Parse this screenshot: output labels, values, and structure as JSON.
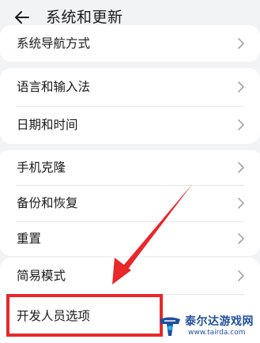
{
  "header": {
    "title": "系统和更新",
    "back_icon": "arrow-left-icon"
  },
  "groups": [
    {
      "items": [
        {
          "label": "系统导航方式",
          "icon": "chevron-right-icon"
        }
      ]
    },
    {
      "items": [
        {
          "label": "语言和输入法",
          "icon": "chevron-right-icon"
        },
        {
          "label": "日期和时间",
          "icon": "chevron-right-icon"
        }
      ]
    },
    {
      "items": [
        {
          "label": "手机克隆",
          "icon": "chevron-right-icon"
        },
        {
          "label": "备份和恢复",
          "icon": "chevron-right-icon"
        },
        {
          "label": "重置",
          "icon": "chevron-right-icon"
        }
      ]
    },
    {
      "items": [
        {
          "label": "简易模式",
          "icon": "chevron-right-icon"
        },
        {
          "label": "开发人员选项"
        }
      ]
    }
  ],
  "annotation": {
    "highlight_color": "#e8282b"
  },
  "watermark": {
    "title": "泰尔达游戏网",
    "url": "www.tairda.com"
  }
}
